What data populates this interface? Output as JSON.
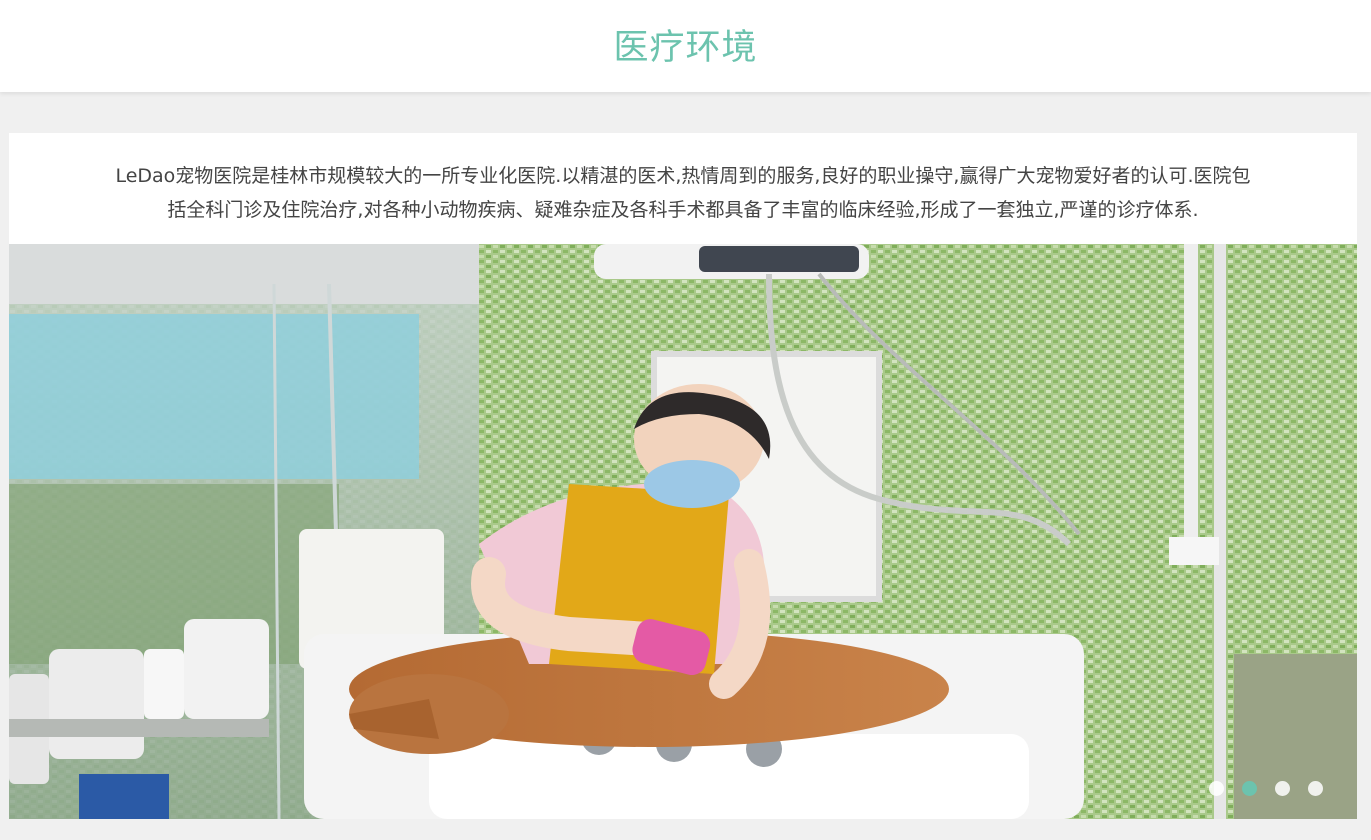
{
  "page": {
    "title": "医疗环境",
    "accent_color": "#6cc3ae"
  },
  "intro": {
    "line1": "LeDao宠物医院是桂林市规模较大的一所专业化医院.以精湛的医术,热情周到的服务,良好的职业操守,赢得广大宠物爱好者的认可.医院包",
    "line2": "括全科门诊及住院治疗,对各种小动物疾病、疑难杂症及各科手术都具备了丰富的临床经验,形成了一套独立,严谨的诊疗体系."
  },
  "slider": {
    "slide_count": 4,
    "active_index": 1,
    "current_slide": "photo-pet-grooming-room"
  }
}
